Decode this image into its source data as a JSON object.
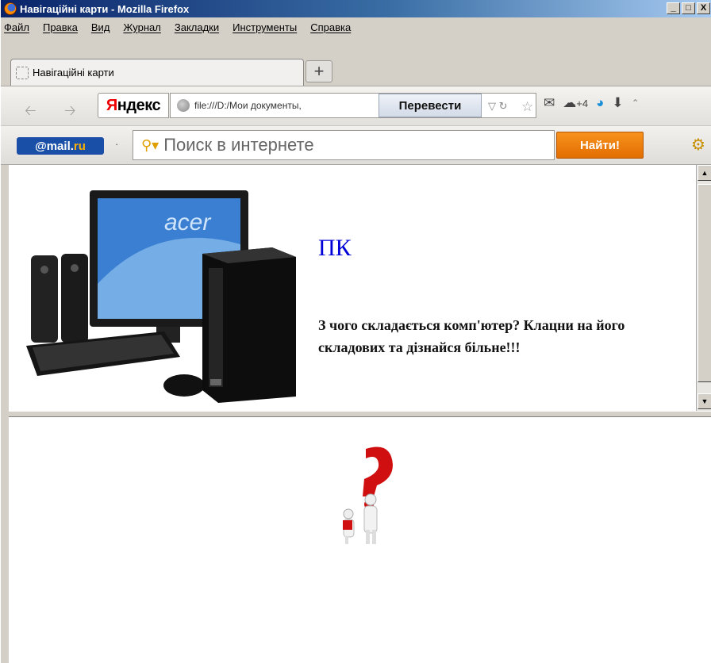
{
  "window": {
    "title": "Навігаційні карти - Mozilla Firefox",
    "min": "_",
    "max": "□",
    "close": "X"
  },
  "menu": [
    "Файл",
    "Правка",
    "Вид",
    "Журнал",
    "Закладки",
    "Инструменты",
    "Справка"
  ],
  "tabs": [
    {
      "label": "Навігаційні карти"
    }
  ],
  "newtab_label": "+",
  "nav": {
    "yandex_brand_first": "Я",
    "yandex_brand_rest": "ндекс",
    "url": "file:///D:/Мои документы,",
    "translate_label": "Перевести",
    "weather": "+4"
  },
  "mailru": {
    "brand_at": "@mail.",
    "brand_ru": "ru",
    "search_placeholder": "Поиск в интернете",
    "find_label": "Найти!"
  },
  "content": {
    "heading": "ПК",
    "description": "З чого складається комп'ютер? Клацни на його складових та дізнайся більне!!!",
    "monitor_brand": "acer"
  },
  "colors": {
    "heading": "#0000d8",
    "find_button": "#f07d10",
    "mailru_brand": "#1a4fa8"
  }
}
